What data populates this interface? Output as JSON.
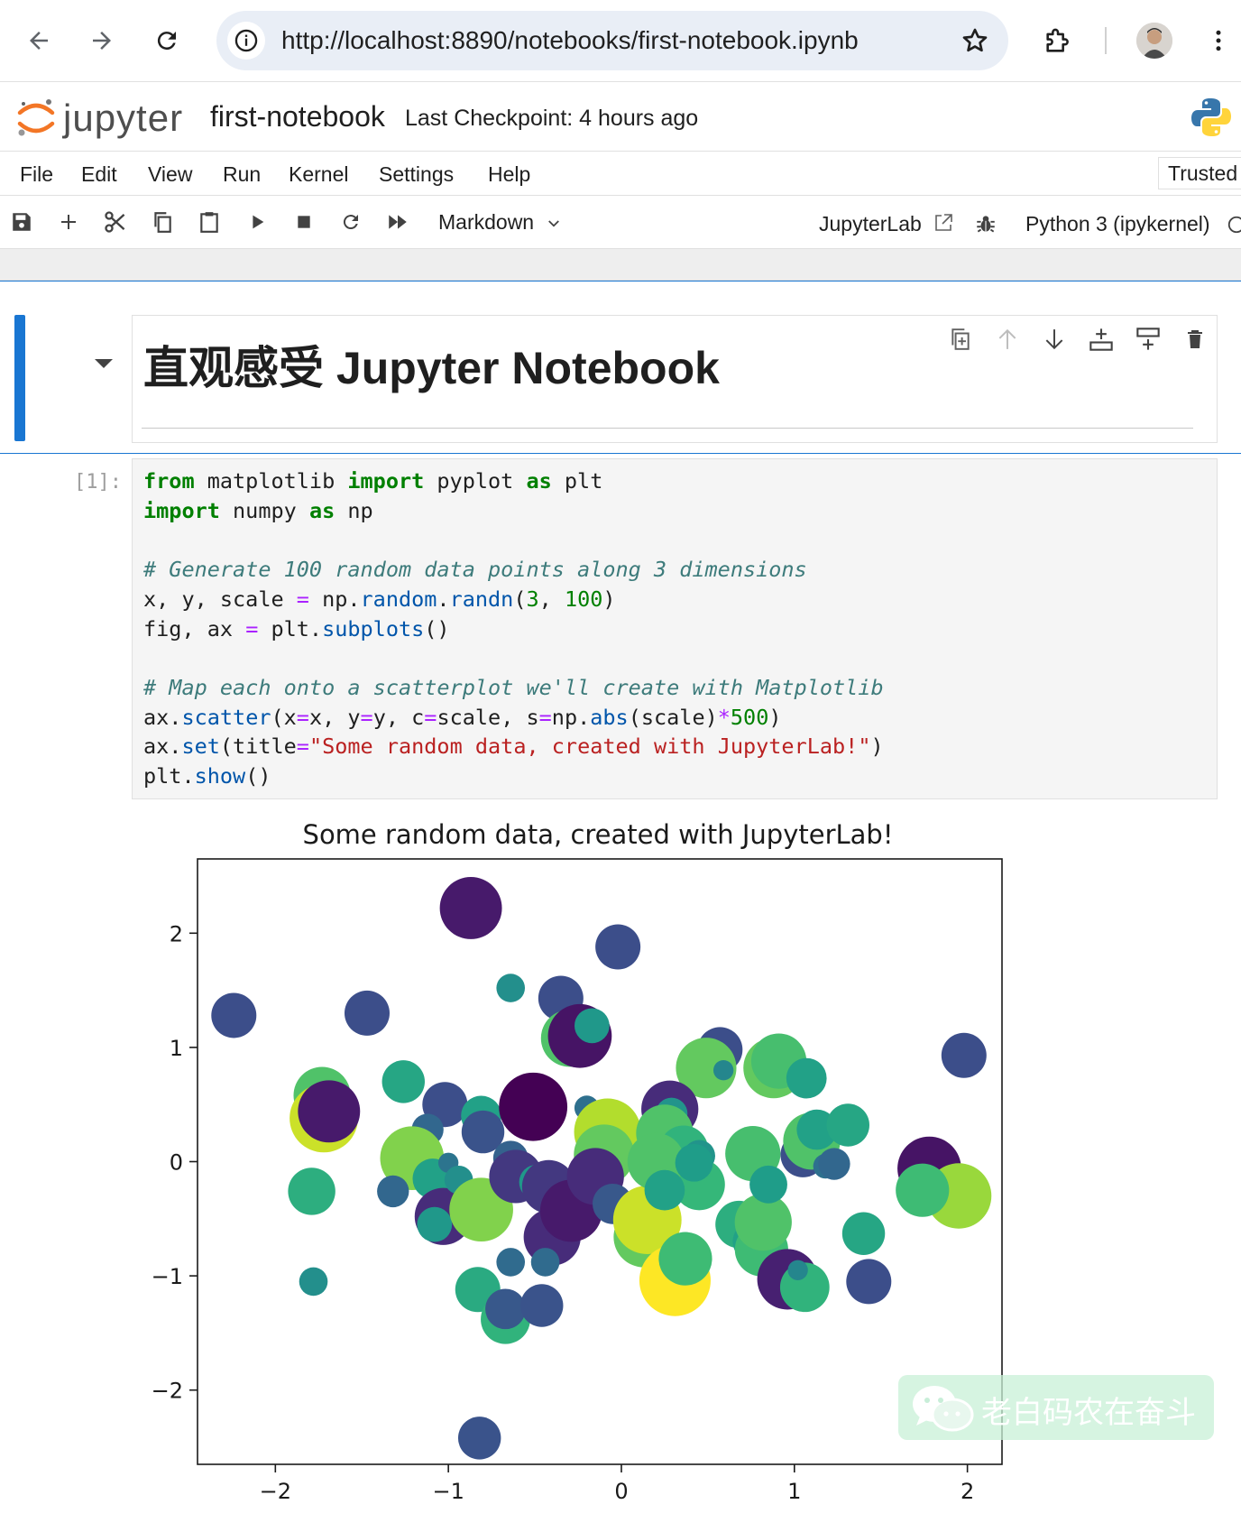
{
  "browser": {
    "url": "http://localhost:8890/notebooks/first-notebook.ipynb"
  },
  "header": {
    "logo_text": "jupyter",
    "notebook_title": "first-notebook",
    "checkpoint": "Last Checkpoint: 4 hours ago"
  },
  "menu": {
    "items": [
      "File",
      "Edit",
      "View",
      "Run",
      "Kernel",
      "Settings",
      "Help"
    ],
    "trusted": "Trusted"
  },
  "toolbar": {
    "cell_type": "Markdown",
    "jupyterlab_label": "JupyterLab",
    "kernel_name": "Python 3 (ipykernel)"
  },
  "markdown_cell": {
    "heading": "直观感受 Jupyter Notebook"
  },
  "code_cell": {
    "prompt": "[1]:"
  },
  "chart_data": {
    "type": "scatter",
    "title": "Some random data, created with JupyterLab!",
    "xlabel": "",
    "ylabel": "",
    "xlim": [
      -2.45,
      2.2
    ],
    "ylim": [
      -2.65,
      2.65
    ],
    "xticks": [
      -2,
      -1,
      0,
      1,
      2
    ],
    "yticks": [
      -2,
      -1,
      0,
      1,
      2
    ],
    "xtick_labels": [
      "−2",
      "−1",
      "0",
      "1",
      "2"
    ],
    "ytick_labels": [
      "−2",
      "−1",
      "0",
      "1",
      "2"
    ],
    "grid": false,
    "colormap": "viridis",
    "points": [
      {
        "x": -0.87,
        "y": 2.22,
        "scale": -1.9
      },
      {
        "x": -0.02,
        "y": 1.88,
        "scale": -1.0
      },
      {
        "x": -2.24,
        "y": 1.28,
        "scale": -1.0
      },
      {
        "x": -1.47,
        "y": 1.3,
        "scale": -1.0
      },
      {
        "x": -0.64,
        "y": 1.52,
        "scale": 0.4
      },
      {
        "x": -0.35,
        "y": 1.43,
        "scale": -1.0
      },
      {
        "x": -0.3,
        "y": 1.08,
        "scale": 1.6
      },
      {
        "x": -0.24,
        "y": 1.1,
        "scale": -2.0
      },
      {
        "x": -0.17,
        "y": 1.19,
        "scale": 0.6
      },
      {
        "x": 0.57,
        "y": 0.98,
        "scale": -1.0
      },
      {
        "x": 0.49,
        "y": 0.82,
        "scale": 1.8
      },
      {
        "x": 0.59,
        "y": 0.8,
        "scale": 0.2
      },
      {
        "x": 0.88,
        "y": 0.82,
        "scale": 1.8
      },
      {
        "x": 0.91,
        "y": 0.88,
        "scale": 1.5
      },
      {
        "x": 1.07,
        "y": 0.73,
        "scale": 0.8
      },
      {
        "x": 1.98,
        "y": 0.93,
        "scale": -1.0
      },
      {
        "x": -1.26,
        "y": 0.7,
        "scale": 0.9
      },
      {
        "x": -1.73,
        "y": 0.58,
        "scale": 1.6
      },
      {
        "x": -1.72,
        "y": 0.38,
        "scale": 2.3
      },
      {
        "x": -1.69,
        "y": 0.44,
        "scale": -1.9
      },
      {
        "x": -1.02,
        "y": 0.5,
        "scale": -1.0
      },
      {
        "x": -1.12,
        "y": 0.28,
        "scale": -0.5
      },
      {
        "x": -0.81,
        "y": 0.4,
        "scale": 0.8
      },
      {
        "x": -0.8,
        "y": 0.26,
        "scale": -0.9
      },
      {
        "x": -0.51,
        "y": 0.48,
        "scale": -2.3
      },
      {
        "x": -0.2,
        "y": 0.47,
        "scale": -0.3
      },
      {
        "x": -0.08,
        "y": 0.26,
        "scale": 2.2
      },
      {
        "x": -0.1,
        "y": 0.06,
        "scale": 1.8
      },
      {
        "x": 0.28,
        "y": 0.46,
        "scale": -1.6
      },
      {
        "x": 0.29,
        "y": 0.42,
        "scale": 0.5
      },
      {
        "x": 0.25,
        "y": 0.25,
        "scale": 1.6
      },
      {
        "x": 0.36,
        "y": 0.1,
        "scale": 1.2
      },
      {
        "x": 0.45,
        "y": 0.05,
        "scale": 0.5
      },
      {
        "x": 0.45,
        "y": -0.2,
        "scale": 1.3
      },
      {
        "x": -1.21,
        "y": 0.03,
        "scale": 2.0
      },
      {
        "x": -1.79,
        "y": -0.26,
        "scale": 1.1
      },
      {
        "x": -1.32,
        "y": -0.26,
        "scale": -0.5
      },
      {
        "x": -1.09,
        "y": -0.15,
        "scale": 0.8
      },
      {
        "x": -1.0,
        "y": -0.01,
        "scale": -0.2
      },
      {
        "x": -1.03,
        "y": -0.48,
        "scale": -1.6
      },
      {
        "x": -1.08,
        "y": -0.55,
        "scale": 0.6
      },
      {
        "x": -0.94,
        "y": -0.16,
        "scale": 0.4
      },
      {
        "x": -0.81,
        "y": -0.42,
        "scale": 2.0
      },
      {
        "x": -0.64,
        "y": 0.03,
        "scale": -0.6
      },
      {
        "x": -0.61,
        "y": -0.13,
        "scale": -1.4
      },
      {
        "x": -0.49,
        "y": -0.18,
        "scale": 0.6
      },
      {
        "x": -0.42,
        "y": -0.22,
        "scale": -1.4
      },
      {
        "x": -0.4,
        "y": -0.66,
        "scale": -1.6
      },
      {
        "x": -0.29,
        "y": -0.43,
        "scale": -1.9
      },
      {
        "x": -0.15,
        "y": -0.13,
        "scale": -1.6
      },
      {
        "x": -0.05,
        "y": -0.37,
        "scale": -0.8
      },
      {
        "x": -0.44,
        "y": -0.88,
        "scale": -0.4
      },
      {
        "x": -0.64,
        "y": -0.88,
        "scale": -0.4
      },
      {
        "x": 0.13,
        "y": -0.66,
        "scale": 1.8
      },
      {
        "x": 0.15,
        "y": -0.51,
        "scale": 2.3
      },
      {
        "x": 0.2,
        "y": 0.0,
        "scale": 1.6
      },
      {
        "x": 0.25,
        "y": -0.25,
        "scale": 0.8
      },
      {
        "x": 0.42,
        "y": -0.01,
        "scale": 0.7
      },
      {
        "x": 0.31,
        "y": -1.04,
        "scale": 2.5
      },
      {
        "x": 0.37,
        "y": -0.85,
        "scale": 1.4
      },
      {
        "x": 0.68,
        "y": -0.55,
        "scale": 1.1
      },
      {
        "x": 0.76,
        "y": -0.7,
        "scale": 0.8
      },
      {
        "x": 0.81,
        "y": -0.77,
        "scale": 1.4
      },
      {
        "x": 0.82,
        "y": -0.53,
        "scale": 1.6
      },
      {
        "x": 0.76,
        "y": 0.07,
        "scale": 1.5
      },
      {
        "x": 0.85,
        "y": -0.2,
        "scale": 0.7
      },
      {
        "x": 1.05,
        "y": 0.06,
        "scale": -1.0
      },
      {
        "x": 1.1,
        "y": 0.18,
        "scale": 1.6
      },
      {
        "x": 1.13,
        "y": 0.28,
        "scale": 0.8
      },
      {
        "x": 1.18,
        "y": -0.04,
        "scale": -0.3
      },
      {
        "x": 1.4,
        "y": -0.63,
        "scale": 0.9
      },
      {
        "x": 1.23,
        "y": -0.02,
        "scale": -0.5
      },
      {
        "x": 0.96,
        "y": -1.03,
        "scale": -1.8
      },
      {
        "x": 1.06,
        "y": -1.1,
        "scale": 1.2
      },
      {
        "x": 1.02,
        "y": -0.95,
        "scale": 0.2
      },
      {
        "x": 1.43,
        "y": -1.05,
        "scale": -1.0
      },
      {
        "x": 1.31,
        "y": 0.32,
        "scale": 0.9
      },
      {
        "x": 1.78,
        "y": -0.06,
        "scale": -2.0
      },
      {
        "x": 1.95,
        "y": -0.3,
        "scale": 2.1
      },
      {
        "x": 1.74,
        "y": -0.25,
        "scale": 1.4
      },
      {
        "x": -1.78,
        "y": -1.05,
        "scale": 0.4
      },
      {
        "x": -0.83,
        "y": -1.12,
        "scale": 1.0
      },
      {
        "x": -0.67,
        "y": -1.38,
        "scale": 1.2
      },
      {
        "x": -0.67,
        "y": -1.29,
        "scale": -0.8
      },
      {
        "x": -0.46,
        "y": -1.26,
        "scale": -0.9
      },
      {
        "x": -0.82,
        "y": -2.42,
        "scale": -0.9
      }
    ]
  }
}
